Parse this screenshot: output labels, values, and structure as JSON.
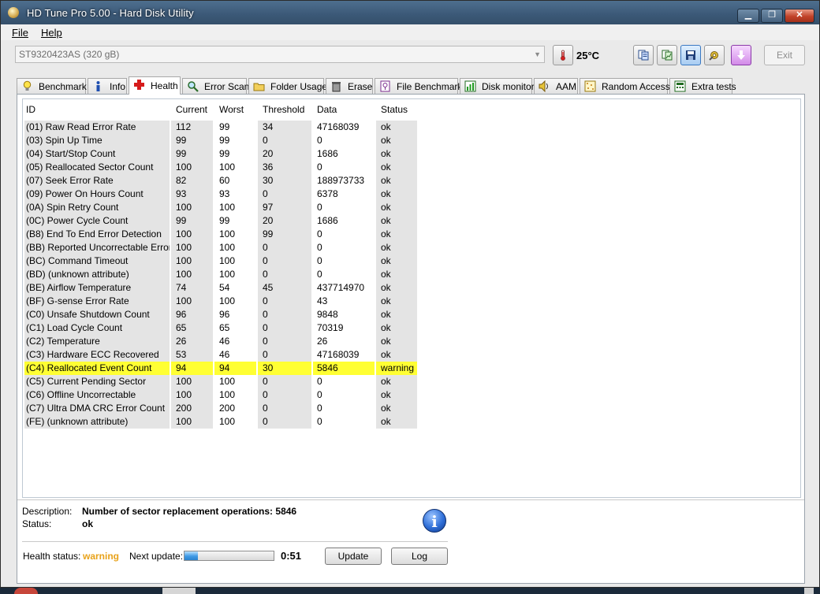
{
  "window": {
    "title": "HD Tune Pro 5.00 - Hard Disk Utility",
    "min": "▁",
    "max": "❐",
    "close": "✕"
  },
  "menu": {
    "file": "File",
    "help": "Help"
  },
  "toolbar": {
    "drive": "ST9320423AS (320 gB)",
    "temperature": "25°C",
    "exit_label": "Exit"
  },
  "tabs": [
    {
      "label": "Benchmark",
      "icon": "lightbulb-icon"
    },
    {
      "label": "Info",
      "icon": "info-icon"
    },
    {
      "label": "Health",
      "icon": "red-cross-icon",
      "active": true
    },
    {
      "label": "Error Scan",
      "icon": "magnifier-icon"
    },
    {
      "label": "Folder Usage",
      "icon": "folder-icon"
    },
    {
      "label": "Erase",
      "icon": "trash-icon"
    },
    {
      "label": "File Benchmark",
      "icon": "file-benchmark-icon"
    },
    {
      "label": "Disk monitor",
      "icon": "monitor-chart-icon"
    },
    {
      "label": "AAM",
      "icon": "speaker-icon"
    },
    {
      "label": "Random Access",
      "icon": "random-dots-icon"
    },
    {
      "label": "Extra tests",
      "icon": "calculator-icon"
    }
  ],
  "table": {
    "headers": {
      "id": "ID",
      "current": "Current",
      "worst": "Worst",
      "threshold": "Threshold",
      "data": "Data",
      "status": "Status"
    },
    "rows": [
      {
        "id": "(01) Raw Read Error Rate",
        "current": "112",
        "worst": "99",
        "threshold": "34",
        "data": "47168039",
        "status": "ok"
      },
      {
        "id": "(03) Spin Up Time",
        "current": "99",
        "worst": "99",
        "threshold": "0",
        "data": "0",
        "status": "ok"
      },
      {
        "id": "(04) Start/Stop Count",
        "current": "99",
        "worst": "99",
        "threshold": "20",
        "data": "1686",
        "status": "ok"
      },
      {
        "id": "(05) Reallocated Sector Count",
        "current": "100",
        "worst": "100",
        "threshold": "36",
        "data": "0",
        "status": "ok"
      },
      {
        "id": "(07) Seek Error Rate",
        "current": "82",
        "worst": "60",
        "threshold": "30",
        "data": "188973733",
        "status": "ok"
      },
      {
        "id": "(09) Power On Hours Count",
        "current": "93",
        "worst": "93",
        "threshold": "0",
        "data": "6378",
        "status": "ok"
      },
      {
        "id": "(0A) Spin Retry Count",
        "current": "100",
        "worst": "100",
        "threshold": "97",
        "data": "0",
        "status": "ok"
      },
      {
        "id": "(0C) Power Cycle Count",
        "current": "99",
        "worst": "99",
        "threshold": "20",
        "data": "1686",
        "status": "ok"
      },
      {
        "id": "(B8) End To End Error Detection",
        "current": "100",
        "worst": "100",
        "threshold": "99",
        "data": "0",
        "status": "ok"
      },
      {
        "id": "(BB) Reported Uncorrectable Errors",
        "current": "100",
        "worst": "100",
        "threshold": "0",
        "data": "0",
        "status": "ok"
      },
      {
        "id": "(BC) Command Timeout",
        "current": "100",
        "worst": "100",
        "threshold": "0",
        "data": "0",
        "status": "ok"
      },
      {
        "id": "(BD) (unknown attribute)",
        "current": "100",
        "worst": "100",
        "threshold": "0",
        "data": "0",
        "status": "ok"
      },
      {
        "id": "(BE) Airflow Temperature",
        "current": "74",
        "worst": "54",
        "threshold": "45",
        "data": "437714970",
        "status": "ok"
      },
      {
        "id": "(BF) G-sense Error Rate",
        "current": "100",
        "worst": "100",
        "threshold": "0",
        "data": "43",
        "status": "ok"
      },
      {
        "id": "(C0) Unsafe Shutdown Count",
        "current": "96",
        "worst": "96",
        "threshold": "0",
        "data": "9848",
        "status": "ok"
      },
      {
        "id": "(C1) Load Cycle Count",
        "current": "65",
        "worst": "65",
        "threshold": "0",
        "data": "70319",
        "status": "ok"
      },
      {
        "id": "(C2) Temperature",
        "current": "26",
        "worst": "46",
        "threshold": "0",
        "data": "26",
        "status": "ok"
      },
      {
        "id": "(C3) Hardware ECC Recovered",
        "current": "53",
        "worst": "46",
        "threshold": "0",
        "data": "47168039",
        "status": "ok"
      },
      {
        "id": "(C4) Reallocated Event Count",
        "current": "94",
        "worst": "94",
        "threshold": "30",
        "data": "5846",
        "status": "warning",
        "selected": true
      },
      {
        "id": "(C5) Current Pending Sector",
        "current": "100",
        "worst": "100",
        "threshold": "0",
        "data": "0",
        "status": "ok"
      },
      {
        "id": "(C6) Offline Uncorrectable",
        "current": "100",
        "worst": "100",
        "threshold": "0",
        "data": "0",
        "status": "ok"
      },
      {
        "id": "(C7) Ultra DMA CRC Error Count",
        "current": "200",
        "worst": "200",
        "threshold": "0",
        "data": "0",
        "status": "ok"
      },
      {
        "id": "(FE) (unknown attribute)",
        "current": "100",
        "worst": "100",
        "threshold": "0",
        "data": "0",
        "status": "ok"
      }
    ]
  },
  "details": {
    "description_label": "Description:",
    "description_value": "Number of sector replacement operations: 5846",
    "status_label": "Status:",
    "status_value": "ok",
    "info_glyph": "i"
  },
  "footer": {
    "health_status_label": "Health status:",
    "health_status_value": "warning",
    "health_status_color": "#e8a21a",
    "next_update_label": "Next update:",
    "progress_fraction": 0.15,
    "countdown": "0:51",
    "update_button": "Update",
    "log_button": "Log"
  },
  "colors": {
    "selection": "#ffff33",
    "titlebar": "#3b5877"
  }
}
